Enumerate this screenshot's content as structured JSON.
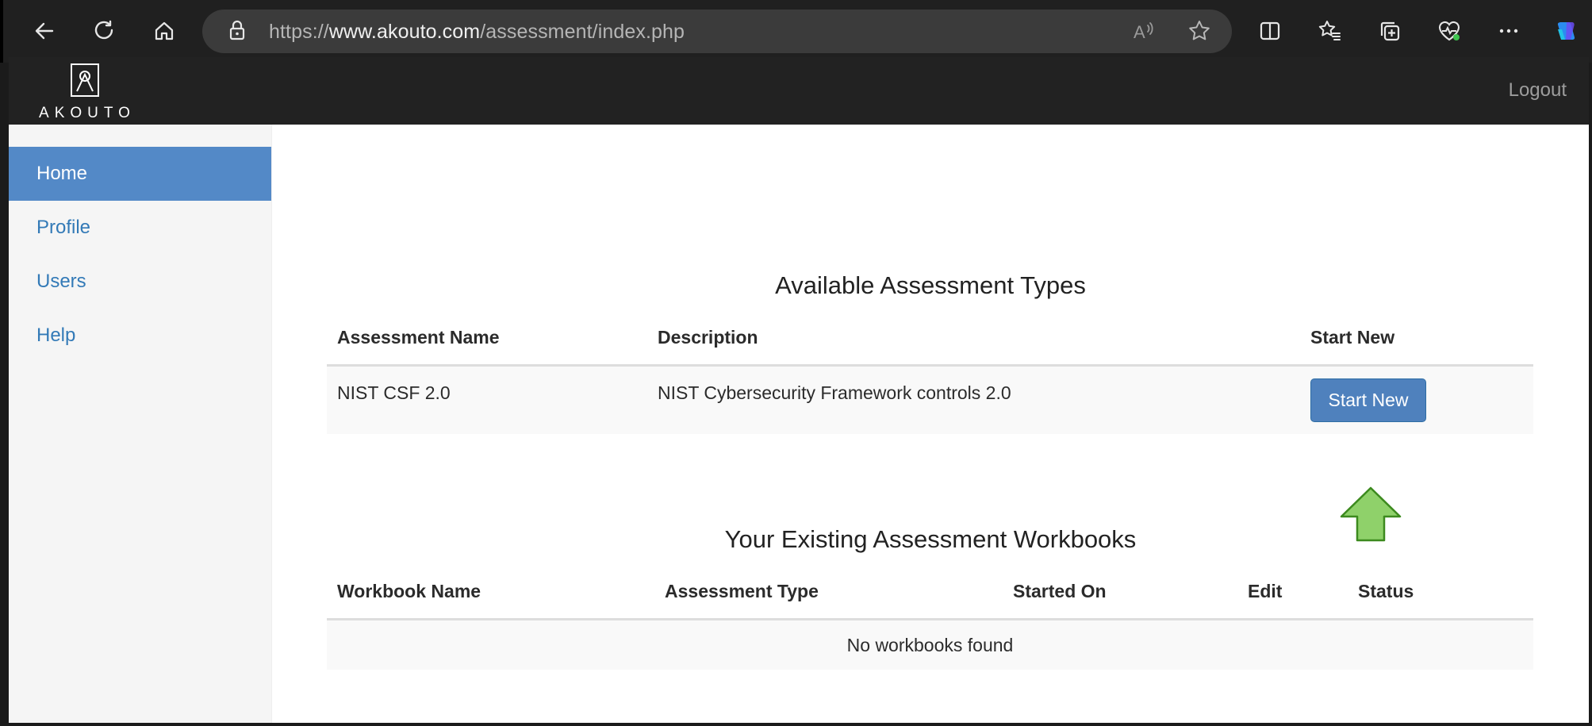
{
  "browser": {
    "url_prefix": "https://",
    "url_host": "www.akouto.com",
    "url_path": "/assessment/index.php",
    "icons": [
      "back-icon",
      "refresh-icon",
      "home-icon",
      "lock-icon",
      "read-aloud-icon",
      "favorite-star-icon",
      "split-screen-icon",
      "favorites-icon",
      "collections-icon",
      "health-icon",
      "more-icon",
      "copilot-icon"
    ]
  },
  "header": {
    "logo_text": "AKOUTO",
    "logout_label": "Logout"
  },
  "sidebar": {
    "items": [
      {
        "label": "Home",
        "active": true
      },
      {
        "label": "Profile",
        "active": false
      },
      {
        "label": "Users",
        "active": false
      },
      {
        "label": "Help",
        "active": false
      }
    ]
  },
  "assessments": {
    "title": "Available Assessment Types",
    "columns": [
      "Assessment Name",
      "Description",
      "Start New"
    ],
    "rows": [
      {
        "name": "NIST CSF 2.0",
        "description": "NIST Cybersecurity Framework controls 2.0",
        "button_label": "Start New"
      }
    ]
  },
  "workbooks": {
    "title": "Your Existing Assessment Workbooks",
    "columns": [
      "Workbook Name",
      "Assessment Type",
      "Started On",
      "Edit",
      "Status"
    ],
    "empty_message": "No workbooks found"
  },
  "colors": {
    "accent": "#5389c7",
    "button": "#4f81bd",
    "link": "#337ab7",
    "arrow_fill": "#8fd16a",
    "arrow_stroke": "#3c8a1e"
  }
}
